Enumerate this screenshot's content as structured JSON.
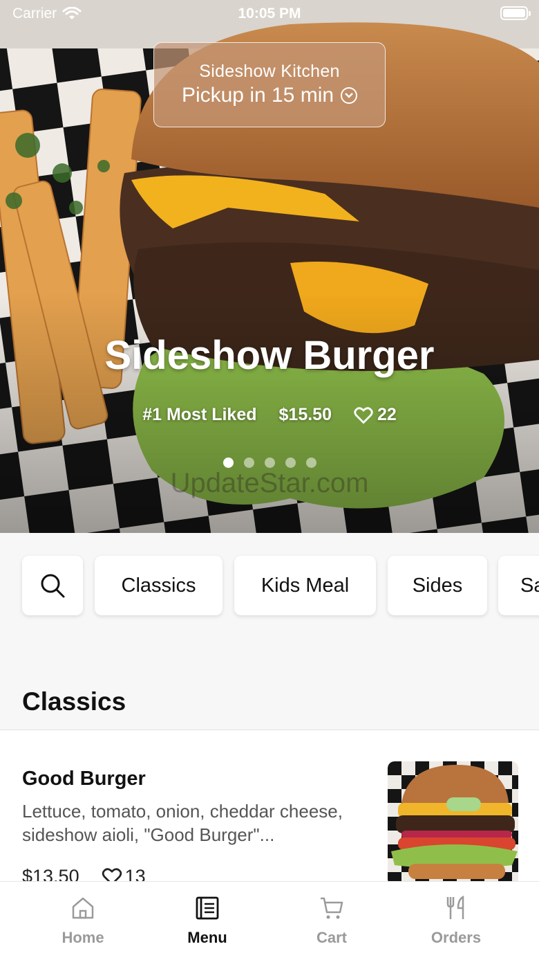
{
  "status_bar": {
    "carrier": "Carrier",
    "time": "10:05 PM"
  },
  "pickup": {
    "kitchen": "Sideshow Kitchen",
    "eta": "Pickup in 15 min"
  },
  "hero": {
    "title": "Sideshow Burger",
    "badge": "#1 Most Liked",
    "price": "$15.50",
    "likes": "22",
    "slides_total": 5,
    "slide_active": 1,
    "watermark": "UpdateStar.com"
  },
  "categories": [
    "Classics",
    "Kids Meal",
    "Sides",
    "Sa"
  ],
  "section": {
    "title": "Classics"
  },
  "items": [
    {
      "name": "Good Burger",
      "description": "Lettuce, tomato, onion, cheddar cheese, sideshow aioli, \"Good Burger\"...",
      "price": "$13.50",
      "likes": "13"
    }
  ],
  "tabs": [
    {
      "label": "Home",
      "icon": "home-icon",
      "active": false
    },
    {
      "label": "Menu",
      "icon": "menu-icon",
      "active": true
    },
    {
      "label": "Cart",
      "icon": "cart-icon",
      "active": false
    },
    {
      "label": "Orders",
      "icon": "orders-icon",
      "active": false
    }
  ]
}
